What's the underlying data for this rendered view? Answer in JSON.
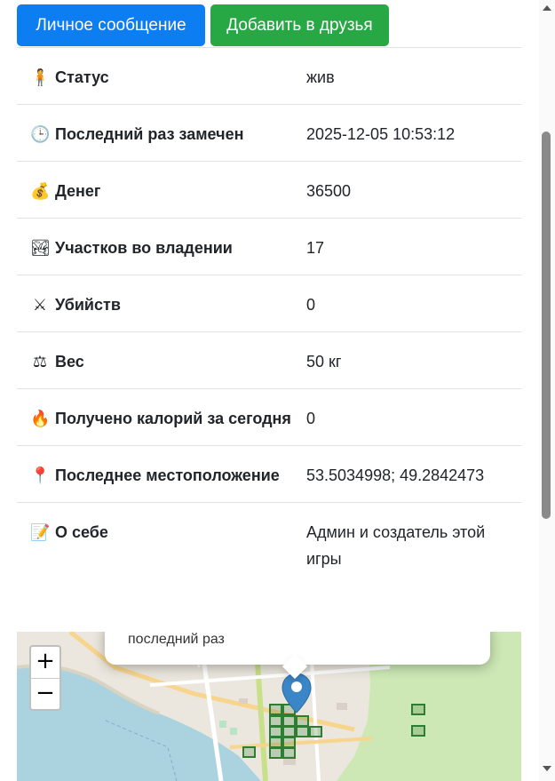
{
  "actions": {
    "message_label": "Личное сообщение",
    "add_friend_label": "Добавить в друзья"
  },
  "profile_rows": [
    {
      "icon": "person-icon",
      "glyph": "🧍",
      "label": "Статус",
      "value": "жив"
    },
    {
      "icon": "clock-icon",
      "glyph": "🕒",
      "label": "Последний раз замечен",
      "value": "2025-12-05 10:53:12"
    },
    {
      "icon": "money-bag-icon",
      "glyph": "💰",
      "label": "Денег",
      "value": "36500"
    },
    {
      "icon": "landscape-icon",
      "glyph": "🏞",
      "label": "Участков во владении",
      "value": "17"
    },
    {
      "icon": "crossed-swords-icon",
      "glyph": "⚔",
      "label": "Убийств",
      "value": "0"
    },
    {
      "icon": "scales-icon",
      "glyph": "⚖",
      "label": "Вес",
      "value": "50 кг"
    },
    {
      "icon": "fire-icon",
      "glyph": "🔥",
      "label": "Получено калорий за сегодня",
      "value": "0"
    },
    {
      "icon": "pushpin-icon",
      "glyph": "📍",
      "label": "Последнее местоположение",
      "value": "53.5034998; 49.2842473"
    },
    {
      "icon": "memo-icon",
      "glyph": "📝",
      "label": "О себе",
      "value": "Админ и создатель этой игры"
    }
  ],
  "map": {
    "zoom_in": "+",
    "zoom_out": "−",
    "popup_text": "последний раз",
    "marker_color": "#3b86c6",
    "plot_color": "#2e7d32",
    "water_color": "#aad3df",
    "forest_color": "#cde8b5"
  }
}
